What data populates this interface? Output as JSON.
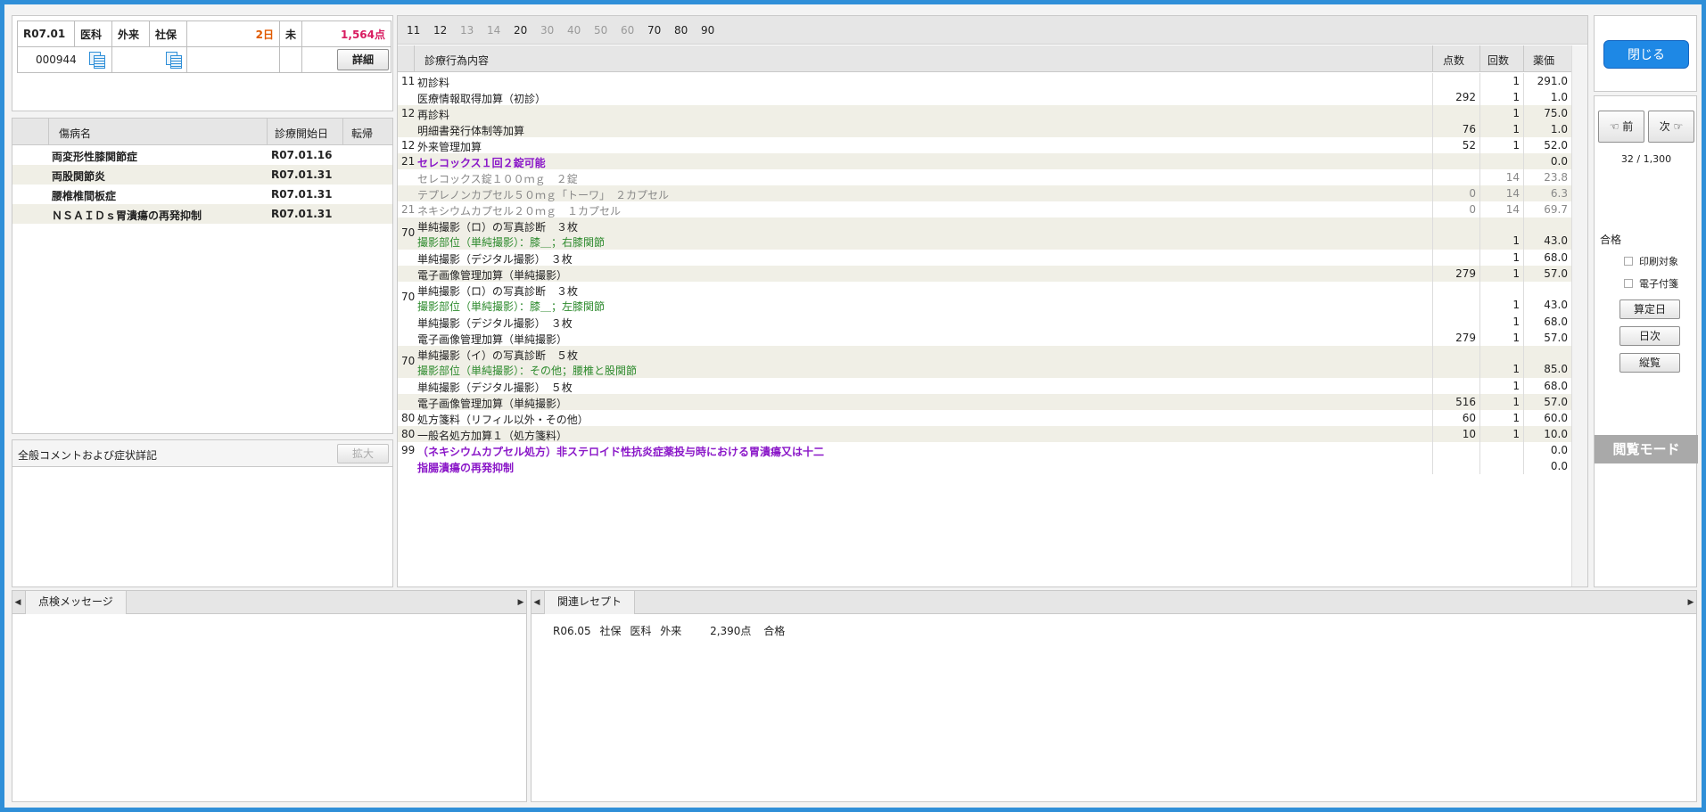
{
  "header": {
    "period": "R07.01",
    "dept": "医科",
    "visit": "外来",
    "insurance": "社保",
    "days": "2日",
    "status": "未",
    "points": "1,564点",
    "patient_id": "000944",
    "detail_label": "詳細"
  },
  "disease": {
    "col_name": "傷病名",
    "col_start": "診療開始日",
    "col_outcome": "転帰",
    "rows": [
      {
        "name": "両変形性膝関節症",
        "start": "R07.01.16"
      },
      {
        "name": "両股関節炎",
        "start": "R07.01.31"
      },
      {
        "name": "腰椎椎間板症",
        "start": "R07.01.31"
      },
      {
        "name": "ＮＳＡＩＤｓ胃潰瘍の再発抑制",
        "start": "R07.01.31"
      }
    ]
  },
  "comment": {
    "title": "全般コメントおよび症状詳記",
    "expand_label": "拡大"
  },
  "tabs": [
    "11",
    "12",
    "13",
    "14",
    "20",
    "30",
    "40",
    "50",
    "60",
    "70",
    "80",
    "90"
  ],
  "columns": {
    "item": "診療行為内容",
    "points": "点数",
    "count": "回数",
    "price": "薬価"
  },
  "treatments": [
    {
      "code": "11",
      "name": "初診料",
      "points": "",
      "count": "1",
      "price": "291.0"
    },
    {
      "code": "",
      "name": "医療情報取得加算（初診）",
      "points": "292",
      "count": "1",
      "price": "1.0"
    },
    {
      "code": "12",
      "name": "再診料",
      "points": "",
      "count": "1",
      "price": "75.0"
    },
    {
      "code": "",
      "name": "明細書発行体制等加算",
      "points": "76",
      "count": "1",
      "price": "1.0"
    },
    {
      "code": "12",
      "name": "外来管理加算",
      "points": "52",
      "count": "1",
      "price": "52.0"
    },
    {
      "code": "21",
      "name": "セレコックス１回２錠可能",
      "points": "",
      "count": "",
      "price": "0.0"
    },
    {
      "code": "",
      "name": "セレコックス錠１００ｍｇ　２錠",
      "points": "",
      "count": "14",
      "price": "23.8"
    },
    {
      "code": "",
      "name": "テプレノンカプセル５０ｍｇ「トーワ」　２カプセル",
      "points": "0",
      "count": "14",
      "price": "6.3"
    },
    {
      "code": "21",
      "name": "ネキシウムカプセル２０ｍｇ　１カプセル",
      "points": "0",
      "count": "14",
      "price": "69.7"
    },
    {
      "code": "70",
      "name": "単純撮影（ロ）の写真診断　３枚",
      "sub": "撮影部位（単純撮影）：膝＿；右膝関節",
      "points": "",
      "count": "1",
      "price": "43.0"
    },
    {
      "code": "",
      "name": "単純撮影（デジタル撮影）　３枚",
      "points": "",
      "count": "1",
      "price": "68.0"
    },
    {
      "code": "",
      "name": "電子画像管理加算（単純撮影）",
      "points": "279",
      "count": "1",
      "price": "57.0"
    },
    {
      "code": "70",
      "name": "単純撮影（ロ）の写真診断　３枚",
      "sub": "撮影部位（単純撮影）：膝＿；左膝関節",
      "points": "",
      "count": "1",
      "price": "43.0"
    },
    {
      "code": "",
      "name": "単純撮影（デジタル撮影）　３枚",
      "points": "",
      "count": "1",
      "price": "68.0"
    },
    {
      "code": "",
      "name": "電子画像管理加算（単純撮影）",
      "points": "279",
      "count": "1",
      "price": "57.0"
    },
    {
      "code": "70",
      "name": "単純撮影（イ）の写真診断　５枚",
      "sub": "撮影部位（単純撮影）：その他；腰椎と股関節",
      "points": "",
      "count": "1",
      "price": "85.0"
    },
    {
      "code": "",
      "name": "単純撮影（デジタル撮影）　５枚",
      "points": "",
      "count": "1",
      "price": "68.0"
    },
    {
      "code": "",
      "name": "電子画像管理加算（単純撮影）",
      "points": "516",
      "count": "1",
      "price": "57.0"
    },
    {
      "code": "80",
      "name": "処方箋料（リフィル以外・その他）",
      "points": "60",
      "count": "1",
      "price": "60.0"
    },
    {
      "code": "80",
      "name": "一般名処方加算１（処方箋料）",
      "points": "10",
      "count": "1",
      "price": "10.0"
    },
    {
      "code": "99",
      "name": "（ネキシウムカプセル処方）非ステロイド性抗炎症薬投与時における胃潰瘍又は十二",
      "points": "",
      "count": "",
      "price": "0.0"
    },
    {
      "code": "",
      "name": "指腸潰瘍の再発抑制",
      "points": "",
      "count": "",
      "price": "0.0"
    }
  ],
  "side": {
    "close_label": "閉じる",
    "prev_label": "前",
    "next_label": "次",
    "position": "32 / 1,300",
    "result": "合格",
    "print_label": "印刷対象",
    "e_attach_label": "電子付箋",
    "calc_day_label": "算定日",
    "daily_label": "日次",
    "overview_label": "縦覧",
    "view_mode": "閲覧モード"
  },
  "bottom": {
    "check_tab": "点検メッセージ",
    "related_tab": "関連レセプト",
    "related_rows": [
      {
        "period": "R06.05",
        "insurance": "社保",
        "dept": "医科",
        "visit": "外来",
        "points": "2,390点",
        "result": "合格"
      }
    ]
  }
}
